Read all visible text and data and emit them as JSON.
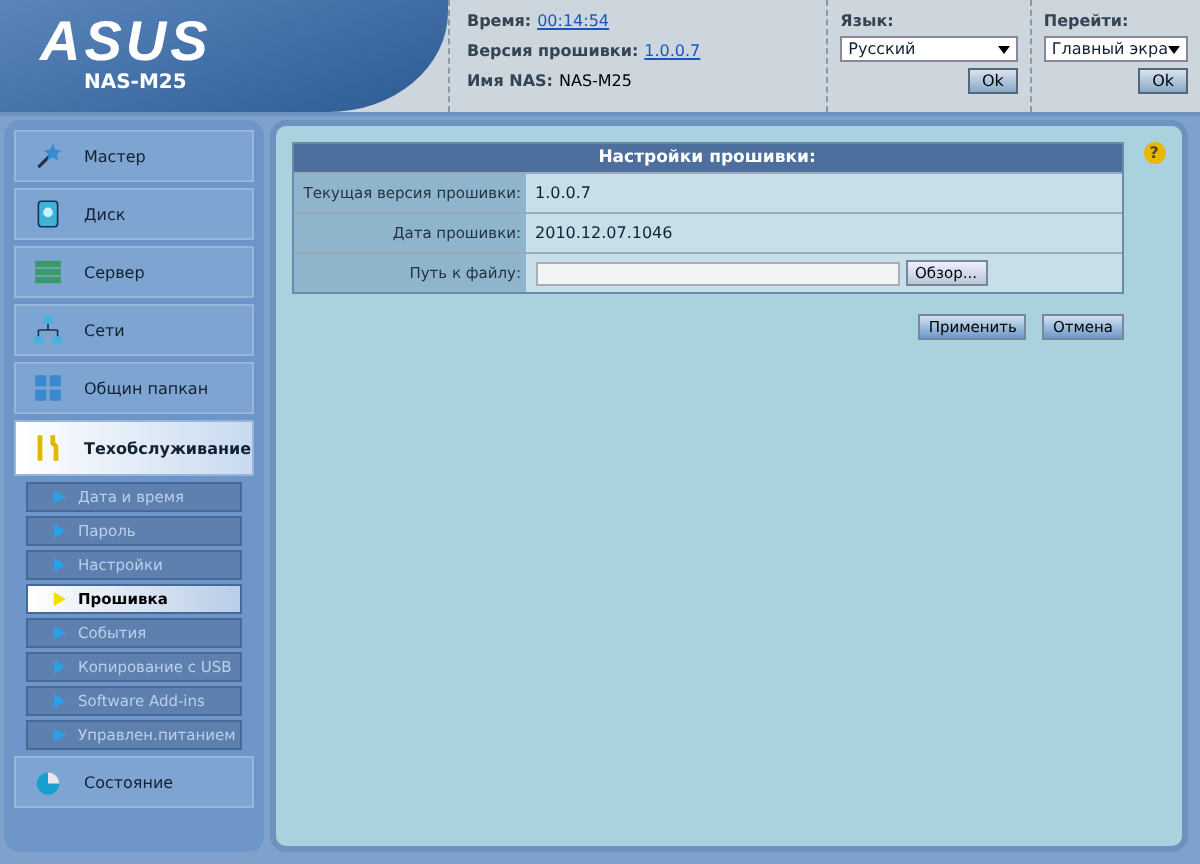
{
  "header": {
    "logo": "ASUS",
    "model": "NAS-M25",
    "time_label": "Время:",
    "time": "00:14:54",
    "firmware_label": "Версия прошивки:",
    "firmware": "1.0.0.7",
    "name_label": "Имя NAS:",
    "name": "NAS-M25",
    "language_label": "Язык:",
    "language": "Русский",
    "language_ok": "Ok",
    "goto_label": "Перейти:",
    "goto": "Главный экра",
    "goto_ok": "Ok"
  },
  "menu": [
    {
      "label": "Мастер",
      "selected": false
    },
    {
      "label": "Диск",
      "selected": false
    },
    {
      "label": "Сервер",
      "selected": false
    },
    {
      "label": "Сети",
      "selected": false
    },
    {
      "label": "Общин папкан",
      "selected": false
    },
    {
      "label": "Техобслуживание",
      "selected": true,
      "children": [
        {
          "label": "Дата и время",
          "selected": false
        },
        {
          "label": "Пароль",
          "selected": false
        },
        {
          "label": "Настройки",
          "selected": false
        },
        {
          "label": "Прошивка",
          "selected": true
        },
        {
          "label": "События",
          "selected": false
        },
        {
          "label": "Копирование с USB",
          "selected": false
        },
        {
          "label": "Software Add-ins",
          "selected": false
        },
        {
          "label": "Управлен.питанием",
          "selected": false
        }
      ]
    },
    {
      "label": "Состояние",
      "selected": false
    }
  ],
  "panel": {
    "title": "Настройки прошивки:",
    "rows": [
      {
        "label": "Текущая версия прошивки:",
        "value": "1.0.0.7",
        "kind": "text"
      },
      {
        "label": "Дата прошивки:",
        "value": "2010.12.07.1046",
        "kind": "text"
      },
      {
        "label": "Путь к файлу:",
        "value": "",
        "kind": "file",
        "browse": "Обзор..."
      }
    ],
    "help": "?",
    "buttons": [
      "Применить",
      "Отмена"
    ]
  }
}
